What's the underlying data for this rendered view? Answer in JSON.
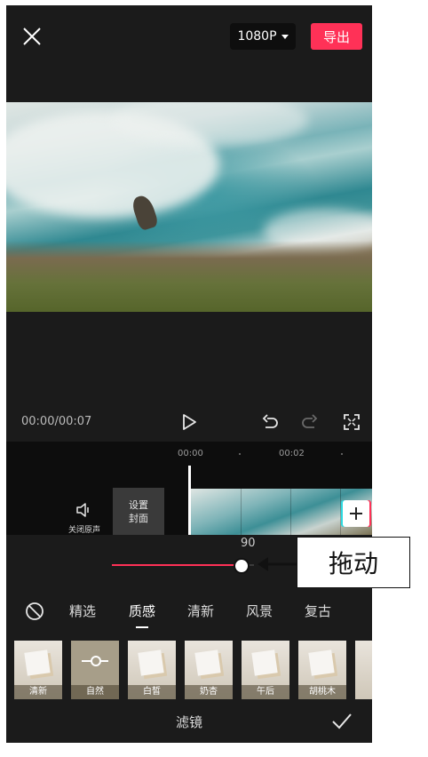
{
  "topbar": {
    "resolution": "1080P",
    "export_label": "导出"
  },
  "playback": {
    "timecode": "00:00/00:07"
  },
  "timeline": {
    "ticks": [
      "00:00",
      "00:02"
    ],
    "mute_label": "关闭原声",
    "cover_label_line1": "设置",
    "cover_label_line2": "封面"
  },
  "filter_slider": {
    "value": "90",
    "fraction": 0.9
  },
  "filter_tabs": [
    "精选",
    "质感",
    "清新",
    "风景",
    "复古"
  ],
  "active_tab_index": 1,
  "filters": [
    "清新",
    "自然",
    "白皙",
    "奶杏",
    "午后",
    "胡桃木"
  ],
  "footer": {
    "title": "滤镜"
  },
  "annotation": {
    "text": "拖动"
  },
  "colors": {
    "accent": "#ff3157",
    "background": "#1b1b1b"
  },
  "icons": [
    "close-icon",
    "chevron-down-icon",
    "play-icon",
    "undo-icon",
    "redo-icon",
    "fullscreen-icon",
    "speaker-icon",
    "add-icon",
    "no-filter-icon",
    "check-icon"
  ]
}
